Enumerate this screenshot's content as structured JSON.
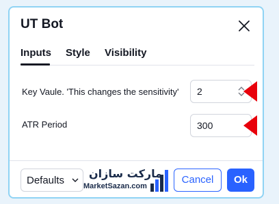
{
  "dialog": {
    "title": "UT Bot",
    "close_icon": "close-icon"
  },
  "tabs": [
    {
      "label": "Inputs",
      "active": true
    },
    {
      "label": "Style",
      "active": false
    },
    {
      "label": "Visibility",
      "active": false
    }
  ],
  "inputs": {
    "key_value": {
      "label": "Key Vaule. 'This changes the sensitivity'",
      "value": "2"
    },
    "atr_period": {
      "label": "ATR Period",
      "value": "300"
    }
  },
  "footer": {
    "defaults_label": "Defaults",
    "cancel_label": "Cancel",
    "ok_label": "Ok"
  },
  "watermark": {
    "persian": "مارکت سازان",
    "domain": "MarketSazan.com"
  },
  "colors": {
    "accent": "#2962ff",
    "marker": "#e8000b",
    "border": "#8fd3f4"
  }
}
